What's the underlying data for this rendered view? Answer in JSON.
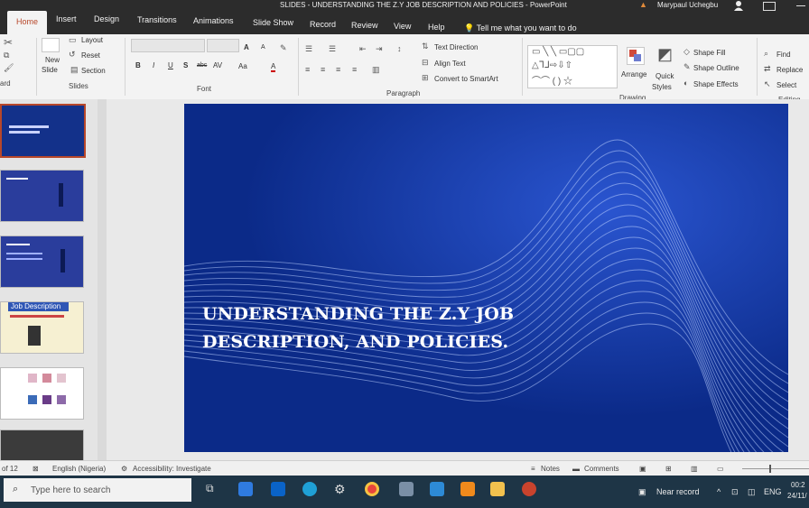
{
  "window": {
    "title": "SLIDES - UNDERSTANDING THE Z.Y JOB DESCRIPTION AND POLICIES - PowerPoint",
    "user": "Marypaul Uchegbu"
  },
  "tabs": [
    "Home",
    "Insert",
    "Design",
    "Transitions",
    "Animations",
    "Slide Show",
    "Record",
    "Review",
    "View",
    "Help"
  ],
  "tell_me": "Tell me what you want to do",
  "ribbon": {
    "slides": {
      "new_slide_1": "New",
      "new_slide_2": "Slide",
      "layout": "Layout",
      "reset": "Reset",
      "section": "Section",
      "label": "Slides"
    },
    "clipboard_label": "ard",
    "font": {
      "bold": "B",
      "italic": "I",
      "underline": "U",
      "strike": "S",
      "abc": "abc",
      "spacing": "AV",
      "case": "Aa",
      "color": "A",
      "grow": "A",
      "shrink": "A",
      "label": "Font"
    },
    "paragraph": {
      "text_direction": "Text Direction",
      "align_text": "Align Text",
      "smartart": "Convert to SmartArt",
      "label": "Paragraph"
    },
    "drawing": {
      "arrange": "Arrange",
      "quick_1": "Quick",
      "quick_2": "Styles",
      "shape_fill": "Shape Fill",
      "shape_outline": "Shape Outline",
      "shape_effects": "Shape Effects",
      "label": "Drawing"
    },
    "editing": {
      "find": "Find",
      "replace": "Replace",
      "select": "Select",
      "label": "Editing"
    }
  },
  "thumbnails": {
    "slide4_title": "Job Description"
  },
  "slide": {
    "title_line1": "UNDERSTANDING THE Z.Y JOB",
    "title_line2": "DESCRIPTION, AND POLICIES."
  },
  "status_bar": {
    "slide_count": "of 12",
    "language": "English (Nigeria)",
    "accessibility": "Accessibility: Investigate",
    "notes": "Notes",
    "comments": "Comments"
  },
  "taskbar": {
    "search_placeholder": "Type here to search",
    "near_record": "Near record",
    "lang": "ENG",
    "time": "00:2",
    "date": "24/11/"
  },
  "colors": {
    "accent": "#b7472a",
    "slide_bg": "#0d2c8c",
    "ribbon_bg": "#f3f3f3"
  }
}
